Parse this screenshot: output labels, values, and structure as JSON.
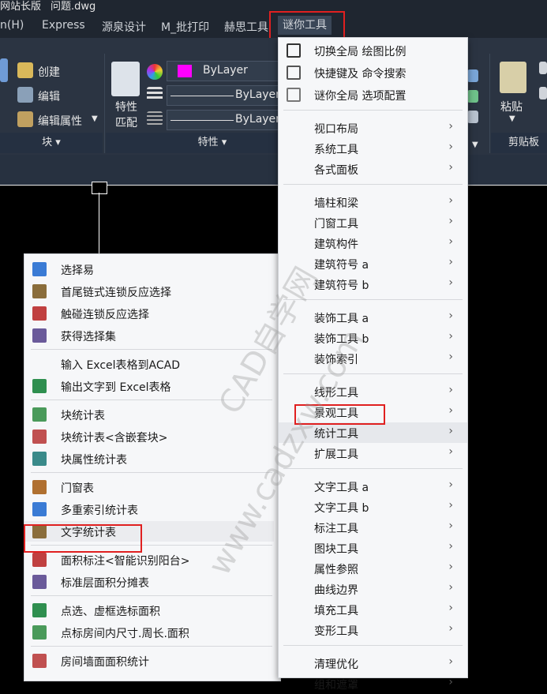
{
  "titlebar": {
    "left": "网站长版",
    "file": "问题.dwg"
  },
  "menubar": {
    "items": [
      "n(H)",
      "Express",
      "源泉设计",
      "M_批打印",
      "赫思工具",
      "谜你工具"
    ]
  },
  "ribbon": {
    "block_panel": {
      "create": "创建",
      "edit": "编辑",
      "edit_attr": "编辑属性",
      "title": "块"
    },
    "props_panel": {
      "match_label_1": "特性",
      "match_label_2": "匹配",
      "color_value": "ByLayer",
      "linetype_value": "ByLayer",
      "lineweight_value": "ByLayer",
      "title": "特性",
      "color_swatch": "#ff00ff"
    },
    "clipboard_panel": {
      "paste": "粘贴",
      "title": "剪贴板"
    }
  },
  "right_menu": {
    "top_items": [
      {
        "label": "切换全局 绘图比例",
        "icon": "scale-icon"
      },
      {
        "label": "快捷键及 命令搜索",
        "icon": "shortcut-icon"
      },
      {
        "label": "谜你全局 选项配置",
        "icon": "gear-icon"
      }
    ],
    "groups": [
      [
        "视口布局",
        "系统工具",
        "各式面板"
      ],
      [
        "墙柱和梁",
        "门窗工具",
        "建筑构件",
        "建筑符号 a",
        "建筑符号 b"
      ],
      [
        "装饰工具 a",
        "装饰工具 b",
        "装饰索引"
      ],
      [
        "线形工具",
        "景观工具",
        "统计工具",
        "扩展工具"
      ],
      [
        "文字工具 a",
        "文字工具 b",
        "标注工具",
        "图块工具",
        "属性参照",
        "曲线边界",
        "填充工具",
        "变形工具"
      ],
      [
        "清理优化",
        "组和遮罩"
      ]
    ],
    "arrow": "›"
  },
  "left_menu": {
    "groups": [
      [
        {
          "label": "选择易",
          "icon": "help-icon"
        },
        {
          "label": "首尾链式连锁反应选择",
          "icon": "chain-icon"
        },
        {
          "label": "触碰连锁反应选择",
          "icon": "touch-icon"
        },
        {
          "label": "获得选择集",
          "icon": "lay-icon"
        }
      ],
      [
        {
          "label": "输入 Excel表格到ACAD",
          "icon": ""
        },
        {
          "label": "输出文字到 Excel表格",
          "icon": "excel-icon"
        }
      ],
      [
        {
          "label": "块统计表",
          "icon": "block-stat-icon"
        },
        {
          "label": "块统计表<含嵌套块>",
          "icon": "block-nested-icon"
        },
        {
          "label": "块属性统计表",
          "icon": "block-attr-icon"
        }
      ],
      [
        {
          "label": "门窗表",
          "icon": "door-icon"
        },
        {
          "label": "多重索引统计表",
          "icon": "multi-index-icon"
        },
        {
          "label": "文字统计表",
          "icon": "text-stat-icon"
        }
      ],
      [
        {
          "label": "面积标注<智能识别阳台>",
          "icon": "area-icon"
        },
        {
          "label": "标准层面积分摊表",
          "icon": "floor-area-icon"
        }
      ],
      [
        {
          "label": "点选、虚框选标面积",
          "icon": "pick-area-icon"
        },
        {
          "label": "点标房间内尺寸.周长.面积",
          "icon": "room-icon"
        }
      ],
      [
        {
          "label": "房间墙面面积统计",
          "icon": "wall-area-icon"
        }
      ]
    ]
  },
  "watermark": {
    "line1": "CAD自学网",
    "line2": "www.cadzxw.com"
  }
}
